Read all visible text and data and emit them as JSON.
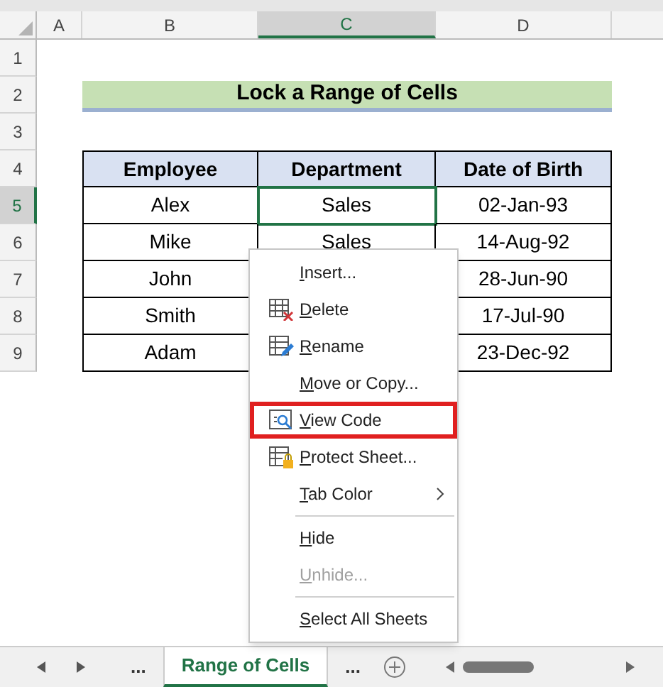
{
  "column_headers": [
    {
      "label": "A",
      "selected": false
    },
    {
      "label": "B",
      "selected": false
    },
    {
      "label": "C",
      "selected": true
    },
    {
      "label": "D",
      "selected": false
    }
  ],
  "row_headers": [
    {
      "label": "1",
      "selected": false
    },
    {
      "label": "2",
      "selected": false
    },
    {
      "label": "3",
      "selected": false
    },
    {
      "label": "4",
      "selected": false
    },
    {
      "label": "5",
      "selected": true
    },
    {
      "label": "6",
      "selected": false
    },
    {
      "label": "7",
      "selected": false
    },
    {
      "label": "8",
      "selected": false
    },
    {
      "label": "9",
      "selected": false
    }
  ],
  "title": "Lock a Range of Cells",
  "table": {
    "columns": [
      "Employee",
      "Department",
      "Date of Birth"
    ],
    "rows": [
      {
        "cells": [
          {
            "text": "Alex",
            "selected": false
          },
          {
            "text": "Sales",
            "selected": true
          },
          {
            "text": "02-Jan-93",
            "selected": false
          }
        ]
      },
      {
        "cells": [
          {
            "text": "Mike",
            "selected": false
          },
          {
            "text": "Sales",
            "selected": false
          },
          {
            "text": "14-Aug-92",
            "selected": false
          }
        ]
      },
      {
        "cells": [
          {
            "text": "John",
            "selected": false
          },
          null,
          {
            "text": "28-Jun-90",
            "selected": false
          }
        ]
      },
      {
        "cells": [
          {
            "text": "Smith",
            "selected": false
          },
          null,
          {
            "text": "17-Jul-90",
            "selected": false
          }
        ]
      },
      {
        "cells": [
          {
            "text": "Adam",
            "selected": false
          },
          null,
          {
            "text": "23-Dec-92",
            "selected": false
          }
        ]
      }
    ]
  },
  "context_menu": [
    {
      "kind": "plain",
      "label": "Insert...",
      "highlighted": false,
      "disabled": false,
      "submenu": false
    },
    {
      "kind": "delete",
      "label": "Delete",
      "highlighted": false,
      "disabled": false,
      "submenu": false
    },
    {
      "kind": "rename",
      "label": "Rename",
      "highlighted": false,
      "disabled": false,
      "submenu": false
    },
    {
      "kind": "plain",
      "label": "Move or Copy...",
      "highlighted": false,
      "disabled": false,
      "submenu": false
    },
    {
      "kind": "viewcode",
      "label": "View Code",
      "highlighted": true,
      "disabled": false,
      "submenu": false
    },
    {
      "kind": "protect",
      "label": "Protect Sheet...",
      "highlighted": false,
      "disabled": false,
      "submenu": false
    },
    {
      "kind": "plain",
      "label": "Tab Color",
      "highlighted": false,
      "disabled": false,
      "submenu": true
    },
    {
      "kind": "separator"
    },
    {
      "kind": "plain",
      "label": "Hide",
      "highlighted": false,
      "disabled": false,
      "submenu": false
    },
    {
      "kind": "plain",
      "label": "Unhide...",
      "highlighted": false,
      "disabled": true,
      "submenu": false
    },
    {
      "kind": "separator"
    },
    {
      "kind": "plain",
      "label": "Select All Sheets",
      "highlighted": false,
      "disabled": false,
      "submenu": false
    }
  ],
  "sheet_tabs": [
    {
      "label": "...",
      "selected": false
    },
    {
      "label": "Range of Cells",
      "selected": true
    },
    {
      "label": "...",
      "selected": false
    }
  ]
}
